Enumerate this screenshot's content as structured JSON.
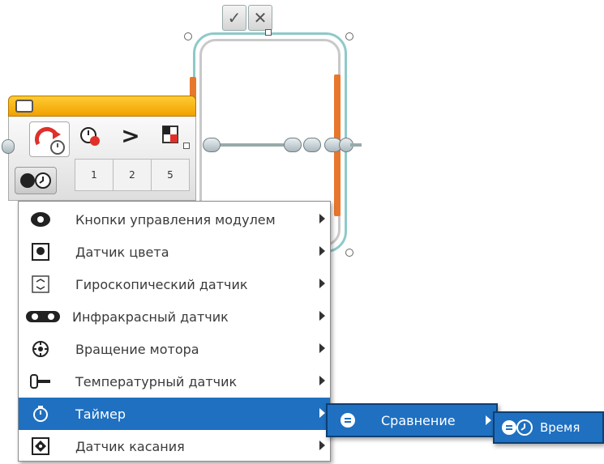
{
  "loop": {
    "confirm_label": "✓",
    "cancel_label": "✕"
  },
  "block": {
    "compare_symbol": ">",
    "params": [
      "1",
      "2",
      "5"
    ]
  },
  "menu": {
    "items": [
      {
        "label": "Кнопки управления модулем",
        "icon": "brick-buttons-icon"
      },
      {
        "label": "Датчик цвета",
        "icon": "color-sensor-icon"
      },
      {
        "label": "Гироскопический датчик",
        "icon": "gyro-sensor-icon"
      },
      {
        "label": "Инфракрасный датчик",
        "icon": "infrared-sensor-icon"
      },
      {
        "label": "Вращение мотора",
        "icon": "motor-rotation-icon"
      },
      {
        "label": "Температурный датчик",
        "icon": "temperature-sensor-icon"
      },
      {
        "label": "Таймер",
        "icon": "timer-icon",
        "selected": true
      },
      {
        "label": "Датчик касания",
        "icon": "touch-sensor-icon"
      }
    ]
  },
  "submenu": {
    "label": "Сравнение",
    "icon": "compare-icon"
  },
  "submenu2": {
    "label": "Время",
    "icon": "time-icon"
  },
  "colors": {
    "selection": "#1f70c1",
    "block_header": "#f0a000",
    "loop_accent": "#e8772e"
  }
}
